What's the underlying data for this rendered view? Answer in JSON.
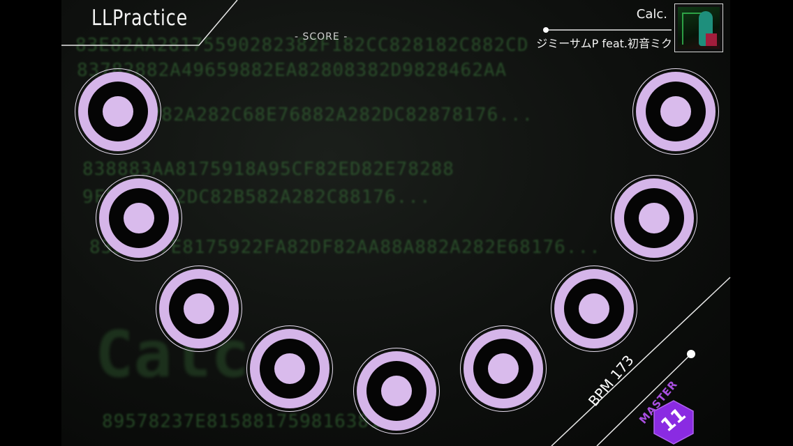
{
  "app": {
    "title": "LLPractice"
  },
  "score": {
    "label": "- SCORE -"
  },
  "song": {
    "title": "Calc.",
    "artist": "ジミーサムP feat.初音ミク",
    "bpm_text": "BPM 173",
    "difficulty": "MASTER",
    "level": "11"
  },
  "background": {
    "lines": [
      "83E82AA28175590282382F182CC828182C882CD",
      "83782882A49659882EA82808382D9828462AA",
      "8282A282C68E76882A282DC82878176...",
      "838883AA8175918A95CF82ED82E78288",
      "9F882AA82DC82B582A282C88176...",
      "8358837E8175922FA82DF82AA88A882A282E68176...",
      "89578237E8158817598163818"
    ],
    "big_text": "Calc."
  },
  "buttons": {
    "count": 9
  },
  "colors": {
    "accent_lilac": "#d5b5e9",
    "difficulty_purple": "#8a2be2",
    "code_green": "#3c7a3c"
  }
}
